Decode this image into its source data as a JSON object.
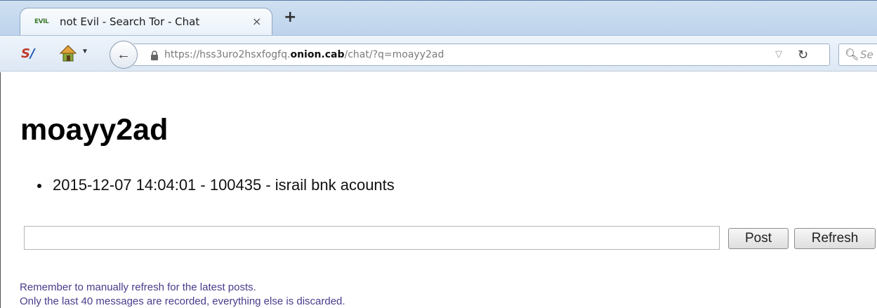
{
  "browser": {
    "tab": {
      "favicon_text": "EVIL",
      "title": "not Evil - Search Tor - Chat",
      "close_glyph": "×"
    },
    "new_tab_glyph": "+",
    "toolbar": {
      "addon_icon": "s-logo-icon",
      "home_icon": "home-icon",
      "back_glyph": "←"
    },
    "url": {
      "prefix": "https://hss3uro2hsxfogfq.",
      "domain": "onion.cab",
      "path": "/chat/?q=moayy2ad"
    },
    "search": {
      "placeholder": "Se"
    }
  },
  "page": {
    "title": "moayy2ad",
    "messages": [
      "2015-12-07 14:04:01 - 100435 - israil bnk acounts"
    ],
    "input_value": "",
    "post_label": "Post",
    "refresh_label": "Refresh",
    "notes": [
      "Remember to manually refresh for the latest posts.",
      "Only the last 40 messages are recorded, everything else is discarded."
    ]
  },
  "colors": {
    "note_text": "#4a3b8c",
    "tabstrip": "#bdd3ec"
  }
}
